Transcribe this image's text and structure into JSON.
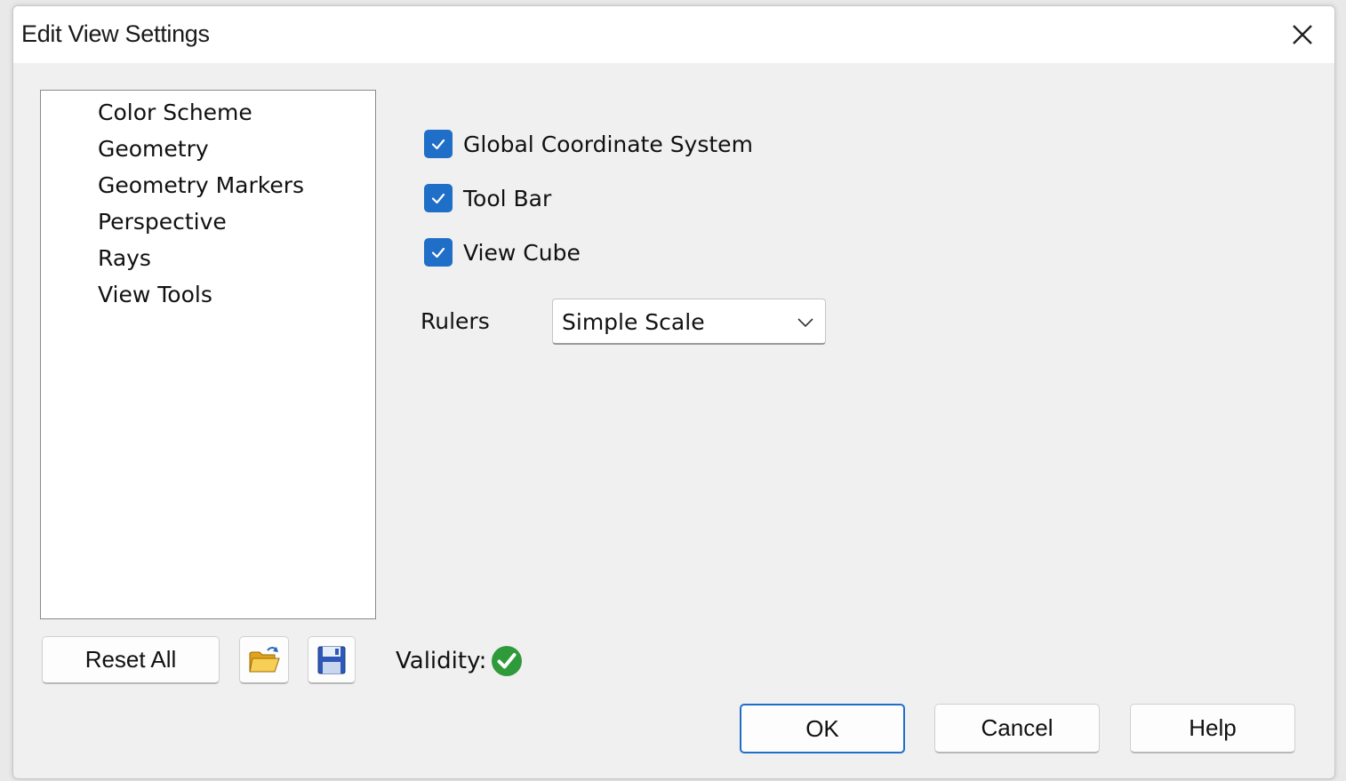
{
  "window": {
    "title": "Edit View Settings"
  },
  "tree": {
    "items": [
      {
        "label": "Color Scheme"
      },
      {
        "label": "Geometry"
      },
      {
        "label": "Geometry Markers"
      },
      {
        "label": "Perspective"
      },
      {
        "label": "Rays"
      },
      {
        "label": "View Tools"
      }
    ]
  },
  "options": {
    "global_coordinate_system": {
      "label": "Global Coordinate System",
      "checked": true
    },
    "tool_bar": {
      "label": "Tool Bar",
      "checked": true
    },
    "view_cube": {
      "label": "View Cube",
      "checked": true
    },
    "rulers": {
      "label": "Rulers",
      "value": "Simple Scale"
    }
  },
  "footer": {
    "reset_all_label": "Reset All",
    "validity_label": "Validity:",
    "ok_label": "OK",
    "cancel_label": "Cancel",
    "help_label": "Help"
  },
  "colors": {
    "accent": "#1f6ec8",
    "valid": "#2e9a3a"
  },
  "icons": {
    "close": "close-icon",
    "open": "open-folder-icon",
    "save": "save-disk-icon",
    "validity": "valid-check-icon",
    "dropdown": "chevron-down-icon"
  }
}
